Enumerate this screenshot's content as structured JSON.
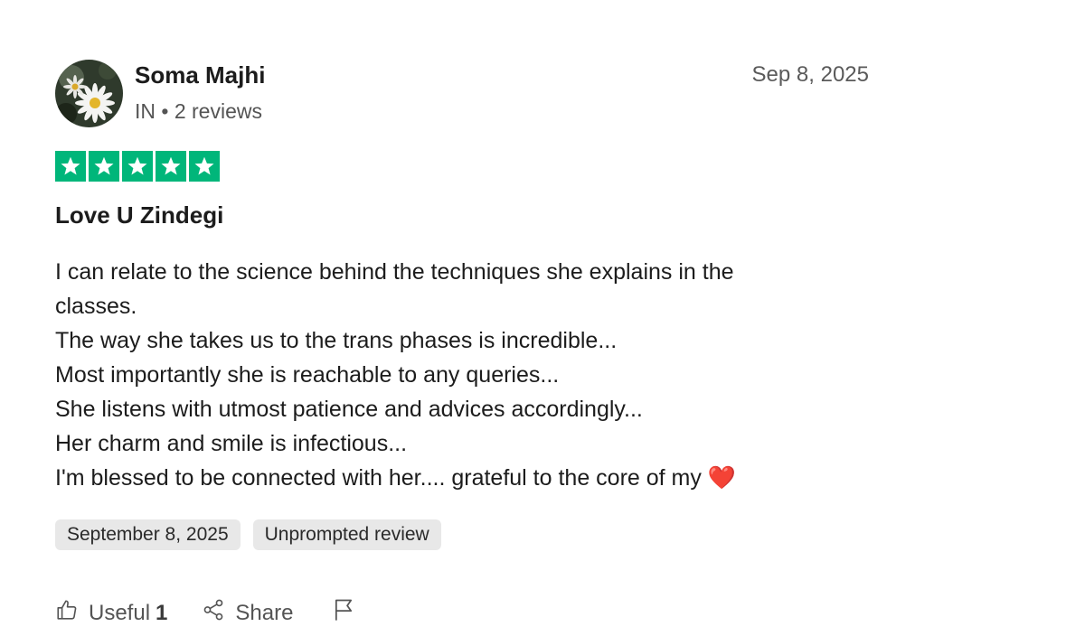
{
  "reviewer": {
    "name": "Soma Majhi",
    "meta": "IN • 2 reviews"
  },
  "review": {
    "date": "Sep 8, 2025",
    "rating": 5,
    "title": "Love U Zindegi",
    "lines": [
      "I can relate to the science behind the techniques she explains in the",
      "classes.",
      "The way she takes us to the trans phases is incredible...",
      "Most importantly she is reachable to any queries...",
      "She listens with utmost patience and advices accordingly...",
      "Her charm and smile is infectious...",
      "I'm blessed to be connected with her.... grateful to the core of my ❤️"
    ],
    "chips": {
      "experience_date": "September 8, 2025",
      "type": "Unprompted review"
    }
  },
  "actions": {
    "useful_label": "Useful",
    "useful_count": "1",
    "share_label": "Share"
  },
  "colors": {
    "star_bg": "#00b67a",
    "chip_bg": "#e8e8e8",
    "muted_text": "#545454"
  },
  "icons": [
    "thumbs-up-icon",
    "share-icon",
    "flag-icon",
    "star-icon"
  ]
}
